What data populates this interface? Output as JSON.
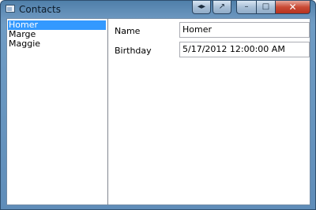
{
  "window": {
    "title": "Contacts",
    "buttons": {
      "extra1_icon": "◂▸",
      "extra2_icon": "↗",
      "minimize_icon": "–",
      "maximize_icon": "□",
      "close_icon": "✕"
    }
  },
  "contacts": {
    "items": [
      {
        "label": "Homer"
      },
      {
        "label": "Marge"
      },
      {
        "label": "Maggie"
      }
    ],
    "selected": "Homer"
  },
  "details": {
    "name_label": "Name",
    "name_value": "Homer",
    "birthday_label": "Birthday",
    "birthday_value": "5/17/2012 12:00:00 AM"
  },
  "colors": {
    "selection": "#3399ff",
    "close_button": "#c94a35"
  }
}
